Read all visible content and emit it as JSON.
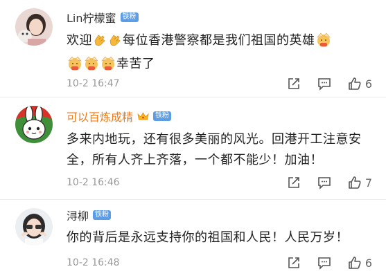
{
  "comments": [
    {
      "user": "Lin柠檬蜜",
      "badge": "铁粉",
      "text_parts": [
        "欢迎",
        "每位香港警察都是我们祖国的英雄",
        "幸苦了"
      ],
      "time": "10-2 16:47",
      "likes": "6",
      "emojis": [
        "clap-emoji",
        "clap-emoji",
        "salute-emoji",
        "salute-emoji",
        "salute-emoji",
        "salute-emoji"
      ]
    },
    {
      "user": "可以百炼成精",
      "badge": "铁粉",
      "text": "多来内地玩，还有很多美丽的风光。回港开工注意安全，所有人齐上齐落，一个都不能少！加油！",
      "time": "10-2 16:46",
      "likes": "7",
      "name_color": "#f07a17"
    },
    {
      "user": "浔柳",
      "badge": "铁粉",
      "text": "你的背后是永远支持你的祖国和人民！人民万岁！",
      "time": "10-2 16:48",
      "likes": "6"
    }
  ]
}
